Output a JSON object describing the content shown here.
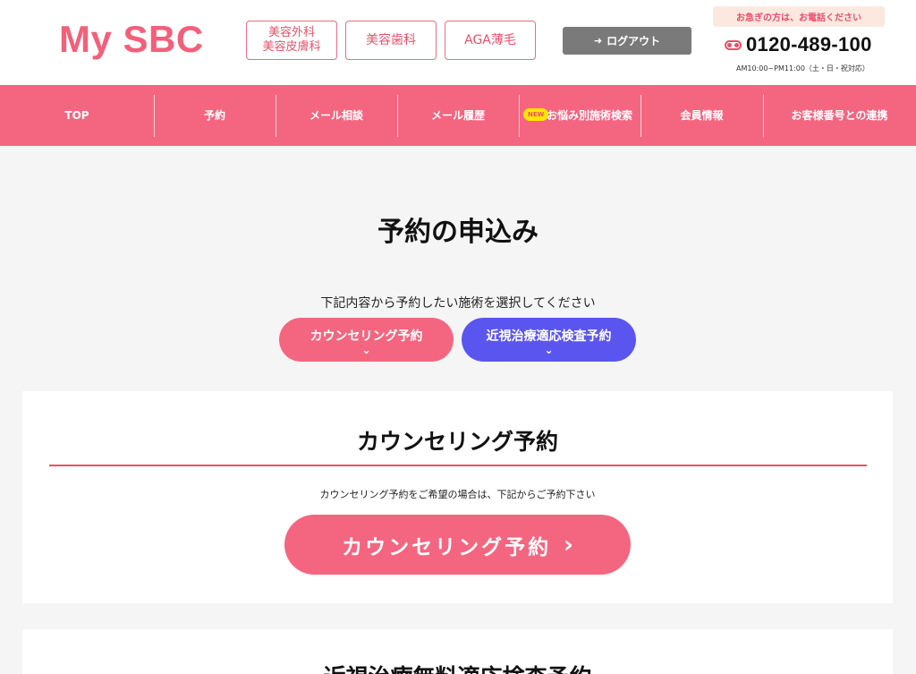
{
  "header": {
    "logo": "My SBC",
    "departments": [
      {
        "label_line1": "美容外科",
        "label_line2": "美容皮膚科"
      },
      {
        "label": "美容歯科"
      },
      {
        "label": "AGA薄毛"
      }
    ],
    "logout_label": "ログアウト",
    "urgent_text": "お急ぎの方は、お電話ください",
    "phone_number": "0120-489-100",
    "hours": "AM10:00~PM11:00（土・日・祝対応）"
  },
  "nav": {
    "items": [
      {
        "label": "TOP"
      },
      {
        "label": "予約"
      },
      {
        "label": "メール相談"
      },
      {
        "label": "メール履歴"
      },
      {
        "label": "お悩み別施術検索",
        "badge": "NEW"
      },
      {
        "label": "会員情報"
      },
      {
        "label": "お客様番号との連携"
      }
    ]
  },
  "main": {
    "title": "予約の申込み",
    "lead": "下記内容から予約したい施術を選択してください",
    "anchors": [
      {
        "label": "カウンセリング予約"
      },
      {
        "label": "近視治療適応検査予約"
      }
    ],
    "sections": [
      {
        "title": "カウンセリング予約",
        "description": "カウンセリング予約をご希望の場合は、下記からご予約下さい",
        "cta_label": "カウンセリング予約"
      },
      {
        "title": "近視治療無料適応検査予約"
      }
    ]
  },
  "colors": {
    "brand_pink": "#f46680",
    "accent_blue": "#5b55f0",
    "logout_gray": "#7a7a7a",
    "badge_yellow": "#ffe600"
  }
}
